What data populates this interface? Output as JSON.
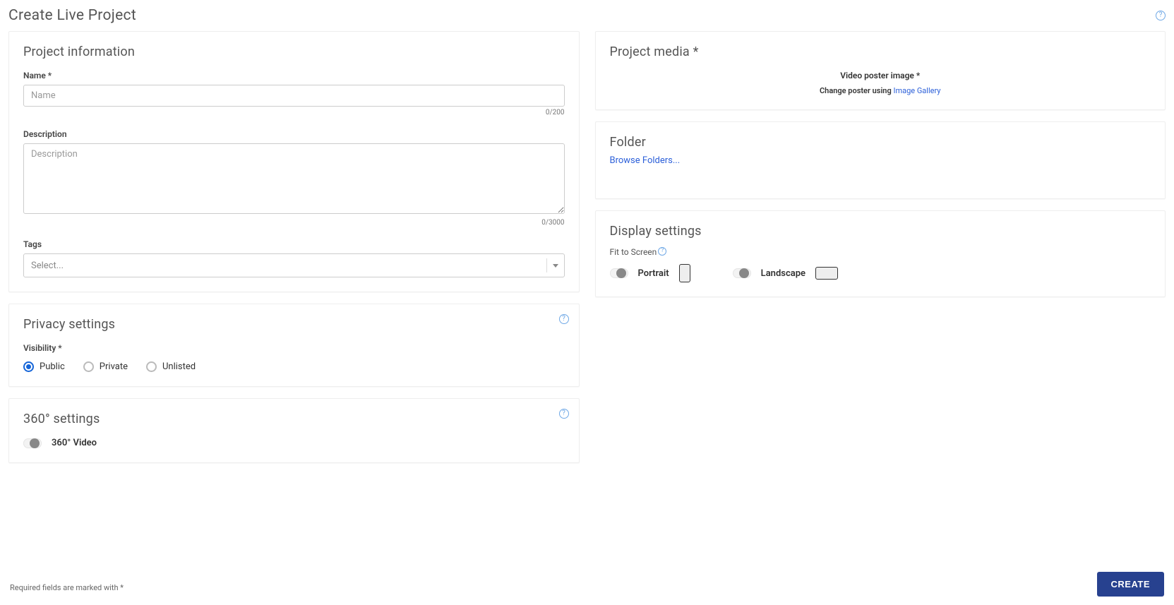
{
  "page_title": "Create Live Project",
  "footer_note": "Required fields are marked with *",
  "create_button": "CREATE",
  "project_info": {
    "title": "Project information",
    "name_label": "Name *",
    "name_placeholder": "Name",
    "name_count": "0/200",
    "desc_label": "Description",
    "desc_placeholder": "Description",
    "desc_count": "0/3000",
    "tags_label": "Tags",
    "tags_placeholder": "Select..."
  },
  "privacy": {
    "title": "Privacy settings",
    "visibility_label": "Visibility *",
    "options": {
      "public": "Public",
      "private": "Private",
      "unlisted": "Unlisted"
    },
    "selected": "public"
  },
  "settings360": {
    "title": "360° settings",
    "toggle_label": "360° Video"
  },
  "media": {
    "title": "Project media *",
    "poster_label": "Video poster image *",
    "change_prefix": "Change poster using ",
    "gallery_link": "Image Gallery"
  },
  "folder": {
    "title": "Folder",
    "browse_link": "Browse Folders..."
  },
  "display": {
    "title": "Display settings",
    "fit_label": "Fit to Screen",
    "portrait_label": "Portrait",
    "landscape_label": "Landscape"
  }
}
